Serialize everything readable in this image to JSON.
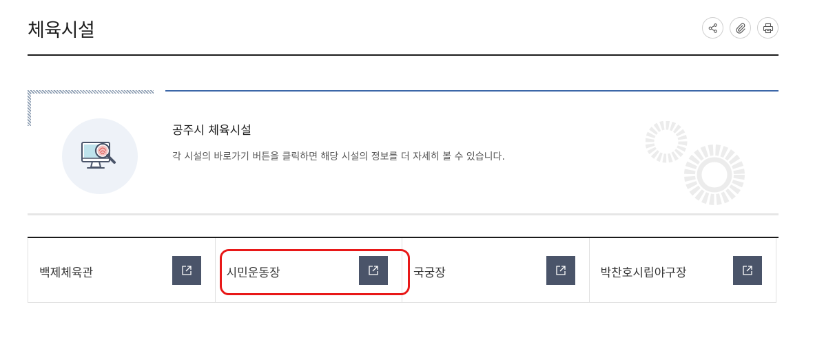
{
  "page": {
    "title": "체육시설",
    "tools": [
      {
        "icon": "share-icon"
      },
      {
        "icon": "paperclip-icon"
      },
      {
        "icon": "print-icon"
      }
    ]
  },
  "intro": {
    "icon": "magnifier-monitor-icon",
    "title": "공주시 체육시설",
    "description": "각 시설의 바로가기 버튼을 클릭하면 해당 시설의 정보를 더 자세히 볼 수 있습니다.",
    "accent_color": "#3c67a8"
  },
  "facilities": [
    {
      "name": "백제체육관",
      "icon": "external-link-icon"
    },
    {
      "name": "시민운동장",
      "icon": "external-link-icon"
    },
    {
      "name": "국궁장",
      "icon": "external-link-icon"
    },
    {
      "name": "박찬호시립야구장",
      "icon": "external-link-icon"
    }
  ],
  "colors": {
    "link_button": "#4a5469",
    "highlight": "#e81818"
  }
}
